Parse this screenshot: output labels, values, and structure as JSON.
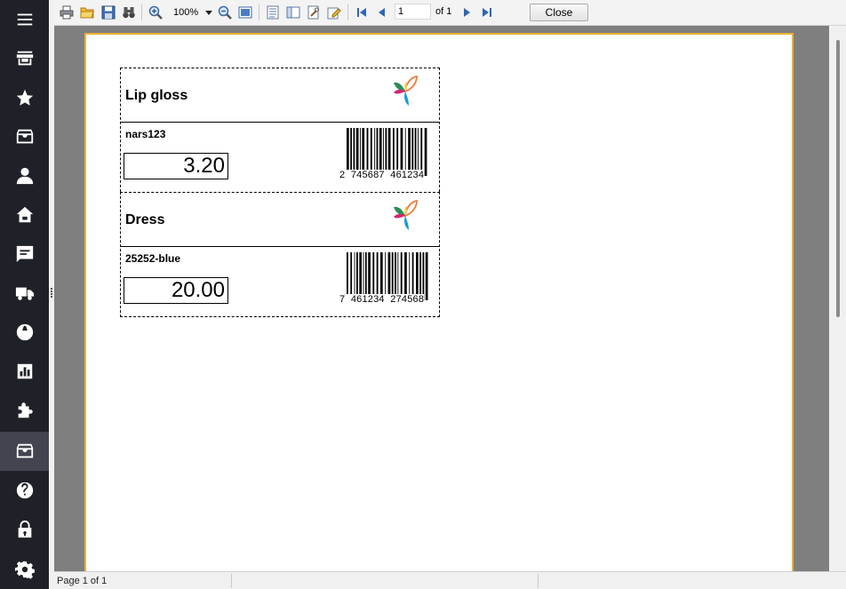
{
  "sidebar": {
    "items": [
      {
        "icon": "menu-icon"
      },
      {
        "icon": "store-icon"
      },
      {
        "icon": "star-icon"
      },
      {
        "icon": "inbox-icon"
      },
      {
        "icon": "person-icon"
      },
      {
        "icon": "home-basket-icon"
      },
      {
        "icon": "chat-icon"
      },
      {
        "icon": "truck-icon"
      },
      {
        "icon": "globe-icon"
      },
      {
        "icon": "chart-icon"
      },
      {
        "icon": "puzzle-icon"
      },
      {
        "icon": "archive-icon",
        "active": true
      },
      {
        "icon": "help-icon"
      },
      {
        "icon": "lock-icon"
      },
      {
        "icon": "gear-icon"
      }
    ]
  },
  "toolbar": {
    "zoom_value": "100%",
    "page_value": "1",
    "page_total": "of 1",
    "close_label": "Close"
  },
  "labels": [
    {
      "title": "Lip gloss",
      "sku": "nars123",
      "price": "3.20",
      "barcode": "2  745687  461234"
    },
    {
      "title": "Dress",
      "sku": "25252-blue",
      "price": "20.00",
      "barcode": "7  461234  274568"
    }
  ],
  "statusbar": {
    "text": "Page 1 of 1"
  },
  "colors": {
    "sidebar": "#1f2128",
    "sidebar_active": "#42454f",
    "page_border": "#e8b13a",
    "preview_bg": "#7f7f7f"
  }
}
